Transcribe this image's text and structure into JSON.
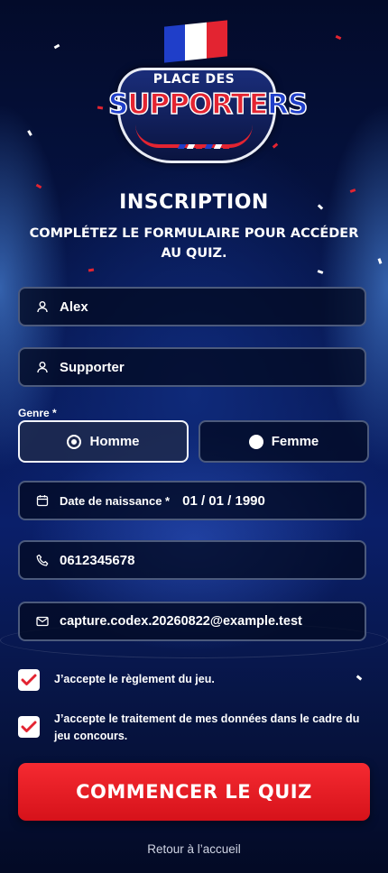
{
  "logo": {
    "top_text": "PLACE DES",
    "main_text": "SUPPORTERS"
  },
  "header": {
    "title": "INSCRIPTION",
    "subtitle": "COMPLÉTEZ LE FORMULAIRE POUR ACCÉDER AU QUIZ."
  },
  "form": {
    "first_name": {
      "value": "Alex",
      "icon": "user-icon"
    },
    "last_name": {
      "value": "Supporter",
      "icon": "user-icon"
    },
    "gender": {
      "label": "Genre *",
      "options": [
        "Homme",
        "Femme"
      ],
      "selected": "Homme"
    },
    "birthdate": {
      "label": "Date de naissance *",
      "value": "01 / 01 / 1990",
      "icon": "calendar-icon"
    },
    "phone": {
      "value": "0612345678",
      "icon": "phone-icon"
    },
    "email": {
      "value": "capture.codex.20260822@example.test",
      "icon": "mail-icon"
    },
    "consents": [
      {
        "text": "J’accepte le règlement du jeu.",
        "checked": true
      },
      {
        "text": "J’accepte le traitement de mes données dans le cadre du jeu concours.",
        "checked": true
      }
    ],
    "submit_label": "COMMENCER LE QUIZ"
  },
  "footer": {
    "back_link": "Retour à l’accueil"
  },
  "colors": {
    "accent": "#e32431",
    "brand_blue": "#1f3ec9",
    "field_border": "#4c5a7c"
  }
}
